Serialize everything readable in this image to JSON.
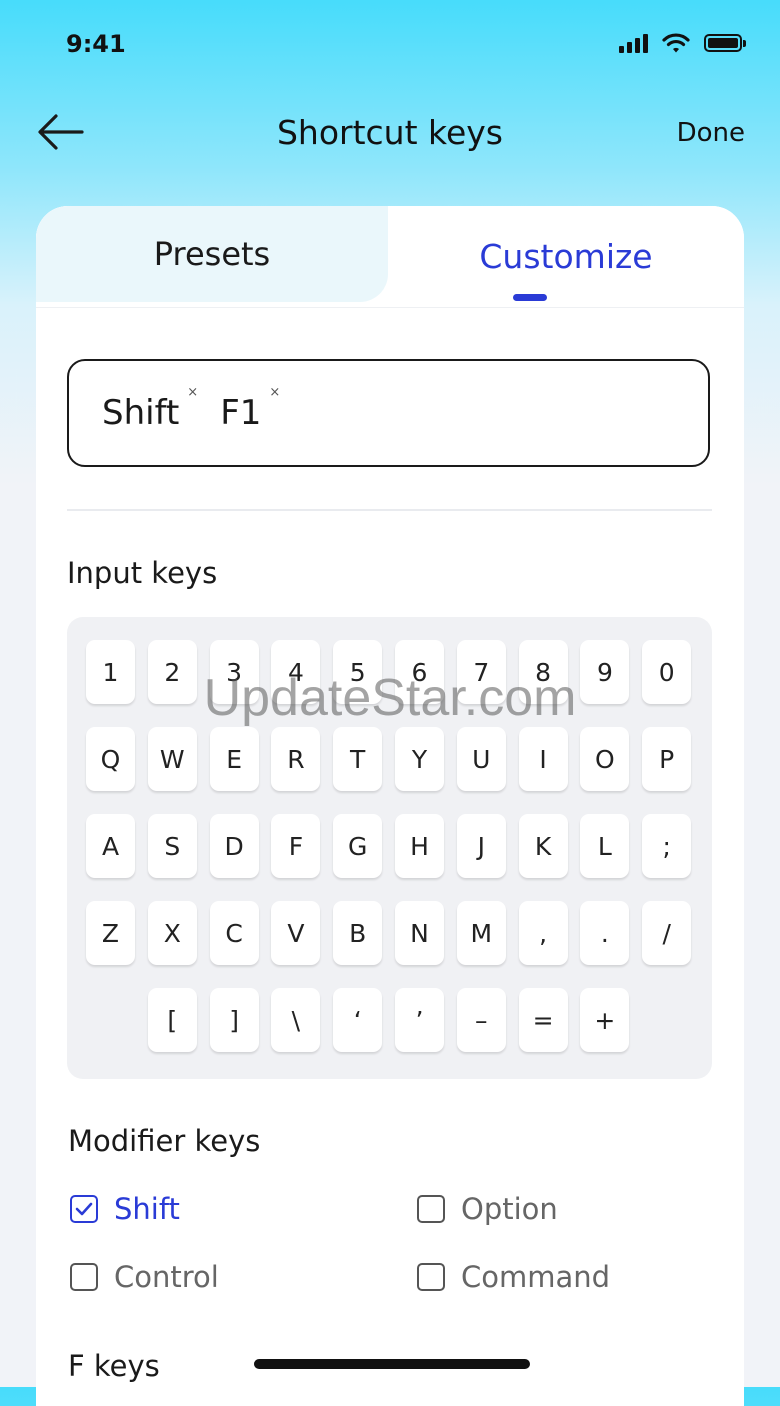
{
  "status_bar": {
    "time": "9:41"
  },
  "header": {
    "title": "Shortcut keys",
    "done_label": "Done"
  },
  "tabs": [
    {
      "label": "Presets",
      "selected": false
    },
    {
      "label": "Customize",
      "selected": true
    }
  ],
  "shortcut": {
    "keys": [
      "Shift",
      "F1"
    ],
    "remove_symbol": "×"
  },
  "input_keys": {
    "label": "Input keys",
    "rows": [
      [
        "1",
        "2",
        "3",
        "4",
        "5",
        "6",
        "7",
        "8",
        "9",
        "0"
      ],
      [
        "Q",
        "W",
        "E",
        "R",
        "T",
        "Y",
        "U",
        "I",
        "O",
        "P"
      ],
      [
        "A",
        "S",
        "D",
        "F",
        "G",
        "H",
        "J",
        "K",
        "L",
        ";"
      ],
      [
        "Z",
        "X",
        "C",
        "V",
        "B",
        "N",
        "M",
        ",",
        ".",
        "/"
      ],
      [
        "[",
        "]",
        "\\",
        "‘",
        "’",
        "–",
        "=",
        "+"
      ]
    ]
  },
  "modifier_keys": {
    "label": "Modifier keys",
    "items": [
      {
        "label": "Shift",
        "checked": true
      },
      {
        "label": "Option",
        "checked": false
      },
      {
        "label": "Control",
        "checked": false
      },
      {
        "label": "Command",
        "checked": false
      }
    ]
  },
  "f_keys": {
    "label": "F keys"
  },
  "watermark": "UpdateStar.com",
  "colors": {
    "accent": "#2a3bd6",
    "header_gradient_top": "#47dcfb"
  }
}
